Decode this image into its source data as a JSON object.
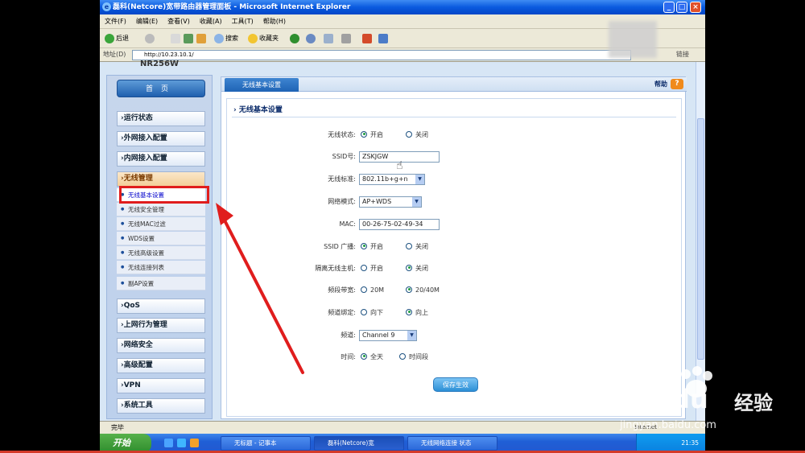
{
  "window": {
    "title": "磊科(Netcore)宽带路由器管理面板 - Microsoft Internet Explorer",
    "btn_min": "_",
    "btn_max": "□",
    "btn_close": "×",
    "ie_glyph": "e"
  },
  "menu": [
    "文件(F)",
    "编辑(E)",
    "查看(V)",
    "收藏(A)",
    "工具(T)",
    "帮助(H)"
  ],
  "toolbar": {
    "back": "后退",
    "search": "搜索",
    "favorites": "收藏夹"
  },
  "address": {
    "label": "地址(D)",
    "url": "http://10.23.10.1/",
    "links": "链接"
  },
  "page": {
    "model": "NR256W",
    "home": "首页",
    "nav_before": [
      "运行状态",
      "外网接入配置",
      "内网接入配置"
    ],
    "nav_open": "无线管理",
    "sub": [
      "无线基本设置",
      "无线安全管理",
      "无线MAC过滤",
      "WDS设置",
      "无线高级设置",
      "无线连接列表",
      "副AP设置"
    ],
    "nav_after": [
      "QoS",
      "上网行为管理",
      "网络安全",
      "高级配置",
      "VPN",
      "系统工具"
    ],
    "tab": "无线基本设置",
    "help": "帮助",
    "help_icon": "?",
    "section": "无线基本设置",
    "form": {
      "wireless_status": {
        "label": "无线状态:",
        "opt1": "开启",
        "opt2": "关闭"
      },
      "ssid": {
        "label": "SSID号:",
        "value": "ZSKJGW"
      },
      "standard": {
        "label": "无线标准:",
        "value": "802.11b+g+n"
      },
      "mode": {
        "label": "网络模式:",
        "value": "AP+WDS"
      },
      "mac": {
        "label": "MAC:",
        "value": "00-26-75-02-49-34"
      },
      "broadcast": {
        "label": "SSID 广播:",
        "opt1": "开启",
        "opt2": "关闭"
      },
      "isolation": {
        "label": "隔离无线主机:",
        "opt1": "开启",
        "opt2": "关闭"
      },
      "bandwidth": {
        "label": "频段带宽:",
        "opt1": "20M",
        "opt2": "20/40M"
      },
      "binding": {
        "label": "频道绑定:",
        "opt1": "向下",
        "opt2": "向上"
      },
      "channel": {
        "label": "频道:",
        "value": "Channel 9"
      },
      "time": {
        "label": "时间:",
        "opt1": "全天",
        "opt2": "时间段"
      },
      "save": "保存生效"
    }
  },
  "status": {
    "left": "完毕",
    "right": "Internet"
  },
  "taskbar": {
    "start": "开始",
    "tasks": [
      "无标题 - 记事本",
      "磊科(Netcore)宽",
      "无线网络连接 状态"
    ],
    "clock": "21:35"
  },
  "watermark": {
    "brand": "Bai du",
    "jingyan": "经验",
    "url": "jingyan.baidu.com"
  },
  "colors": {
    "highlight": "#e01d1d",
    "accent": "#1e63b5"
  }
}
